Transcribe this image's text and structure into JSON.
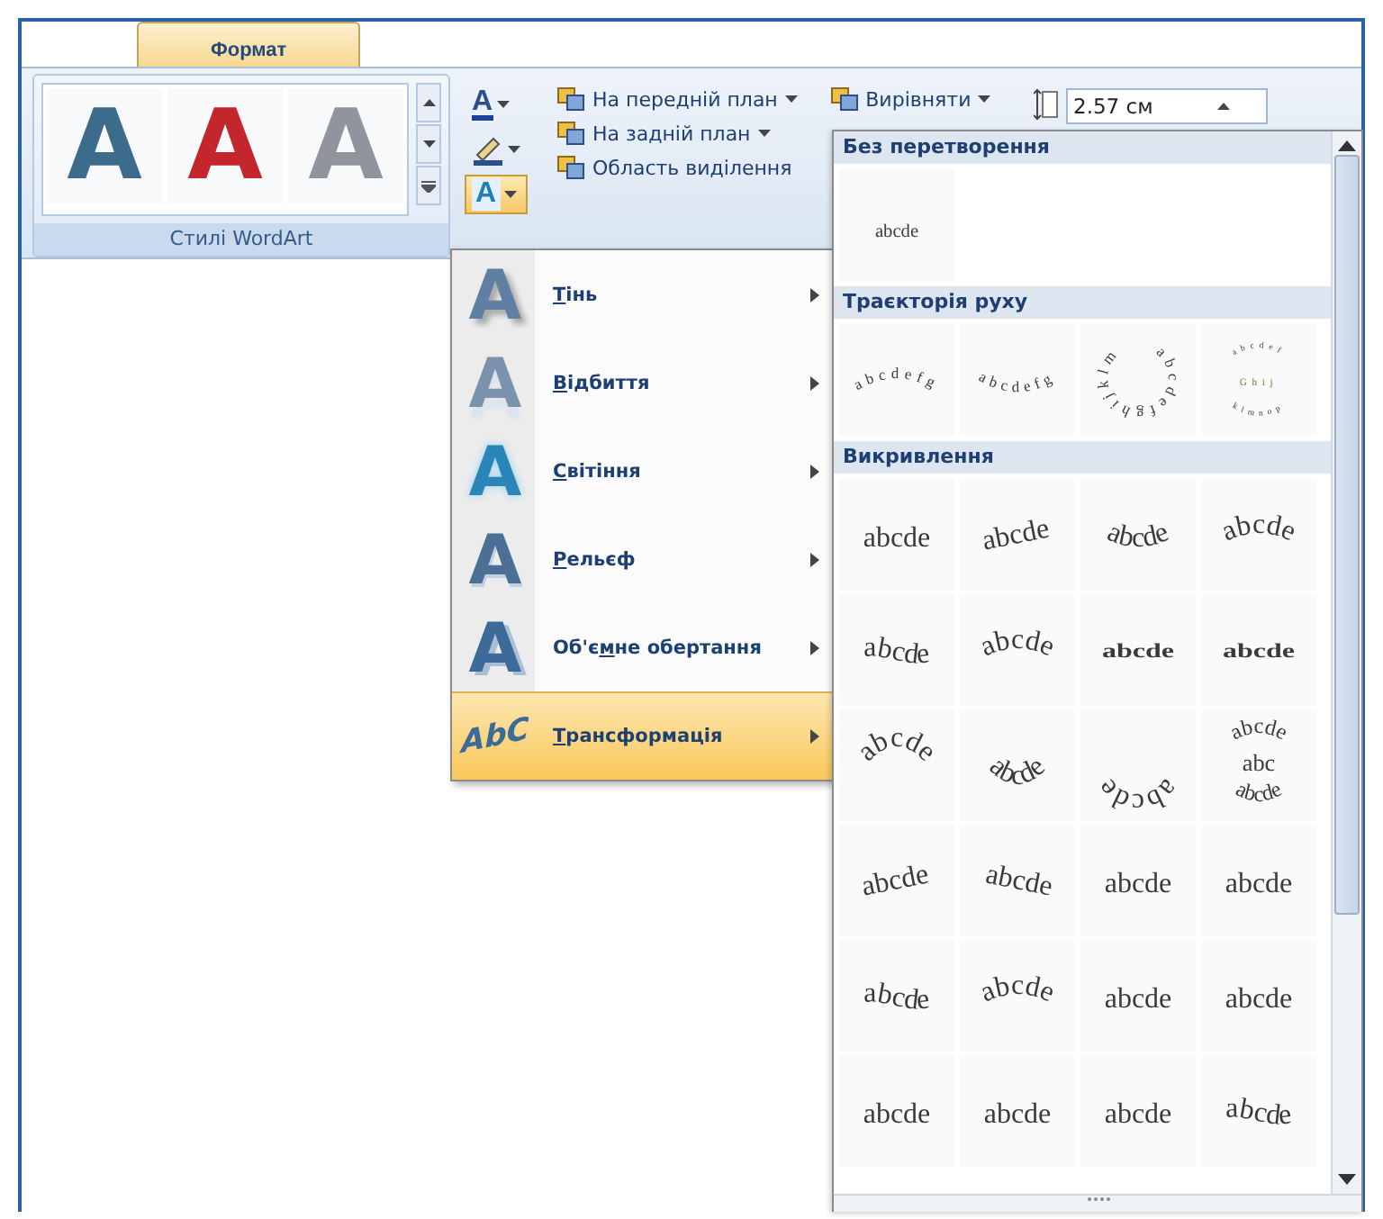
{
  "tabs": [
    {
      "label": "Формат",
      "selected": true
    }
  ],
  "wordart_group": {
    "label": "Стилі WordArt",
    "styles": [
      {
        "glyph": "A",
        "color": "#3d6b8c"
      },
      {
        "glyph": "A",
        "color": "#c4262e"
      },
      {
        "glyph": "A",
        "color": "#8e959c"
      }
    ]
  },
  "text_buttons": [
    {
      "kind": "fill",
      "glyph": "A",
      "pressed": false
    },
    {
      "kind": "outline",
      "pressed": false
    },
    {
      "kind": "effects",
      "glyph": "A",
      "pressed": true
    }
  ],
  "arrange": [
    {
      "label": "На передній план",
      "dropdown": true
    },
    {
      "label": "Вирівняти",
      "dropdown": true
    },
    {
      "label": "На задній план",
      "dropdown": true
    },
    {
      "label": "Область виділення",
      "dropdown": false
    }
  ],
  "size_field": {
    "value": "2.57 см"
  },
  "effects_menu": [
    {
      "glyph": "A",
      "key": "Т",
      "rest": "інь",
      "selected": false
    },
    {
      "glyph": "A",
      "key": "В",
      "rest": "ідбиття",
      "selected": false
    },
    {
      "glyph": "A",
      "key": "С",
      "rest": "вітіння",
      "selected": false
    },
    {
      "glyph": "A",
      "key": "Р",
      "rest": "ельєф",
      "selected": false
    },
    {
      "glyph": "A",
      "prefix": "Об'є",
      "key": "м",
      "rest": "не обертання",
      "selected": false
    },
    {
      "glyph": "AbC",
      "key": "Т",
      "rest": "рансформація",
      "selected": true
    }
  ],
  "gallery": {
    "sections": [
      {
        "title": "Без перетворення",
        "kind": "none",
        "items": [
          {
            "kind": "plain",
            "lines": [
              "abcde"
            ]
          }
        ]
      },
      {
        "title": "Траєкторія руху",
        "kind": "path",
        "items": [
          {
            "kind": "arc-up",
            "lines": [
              "abcdefg"
            ]
          },
          {
            "kind": "arc-down",
            "lines": [
              "abcdefg"
            ]
          },
          {
            "kind": "circle",
            "lines": [
              "abcdefghijklm"
            ]
          },
          {
            "kind": "button",
            "lines": [
              "abcdef",
              "Ghij",
              "klmnop"
            ]
          }
        ]
      },
      {
        "title": "Викривлення",
        "kind": "warp",
        "items": [
          {
            "kind": "plain",
            "lines": [
              "abcde"
            ]
          },
          {
            "kind": "tilt-up",
            "lines": [
              "abcde"
            ]
          },
          {
            "kind": "arc-down",
            "lines": [
              "abcde"
            ]
          },
          {
            "kind": "arc-up",
            "lines": [
              "abcde"
            ]
          },
          {
            "kind": "wave",
            "lines": [
              "abcde"
            ]
          },
          {
            "kind": "arc-up",
            "lines": [
              "abcde"
            ]
          },
          {
            "kind": "squash",
            "lines": [
              "abcde"
            ]
          },
          {
            "kind": "squash",
            "lines": [
              "abcde"
            ]
          },
          {
            "kind": "arch",
            "lines": [
              "abcde"
            ]
          },
          {
            "kind": "arch-down",
            "lines": [
              "abcde"
            ]
          },
          {
            "kind": "circle",
            "lines": [
              "abcde"
            ]
          },
          {
            "kind": "button",
            "lines": [
              "abcde",
              "abc",
              "abcde"
            ]
          },
          {
            "kind": "tilt-up",
            "lines": [
              "abcde"
            ]
          },
          {
            "kind": "tilt-down",
            "lines": [
              "abcde"
            ]
          },
          {
            "kind": "plain",
            "lines": [
              "abcde"
            ]
          },
          {
            "kind": "plain",
            "lines": [
              "abcde"
            ]
          },
          {
            "kind": "wave",
            "lines": [
              "abcde"
            ]
          },
          {
            "kind": "arc-up",
            "lines": [
              "abcde"
            ]
          },
          {
            "kind": "plain",
            "lines": [
              "abcde"
            ]
          },
          {
            "kind": "plain",
            "lines": [
              "abcde"
            ]
          },
          {
            "kind": "plain",
            "lines": [
              "abcde"
            ]
          },
          {
            "kind": "plain",
            "lines": [
              "abcde"
            ]
          },
          {
            "kind": "plain",
            "lines": [
              "abcde"
            ]
          },
          {
            "kind": "wave",
            "lines": [
              "abcde"
            ]
          }
        ]
      }
    ]
  }
}
